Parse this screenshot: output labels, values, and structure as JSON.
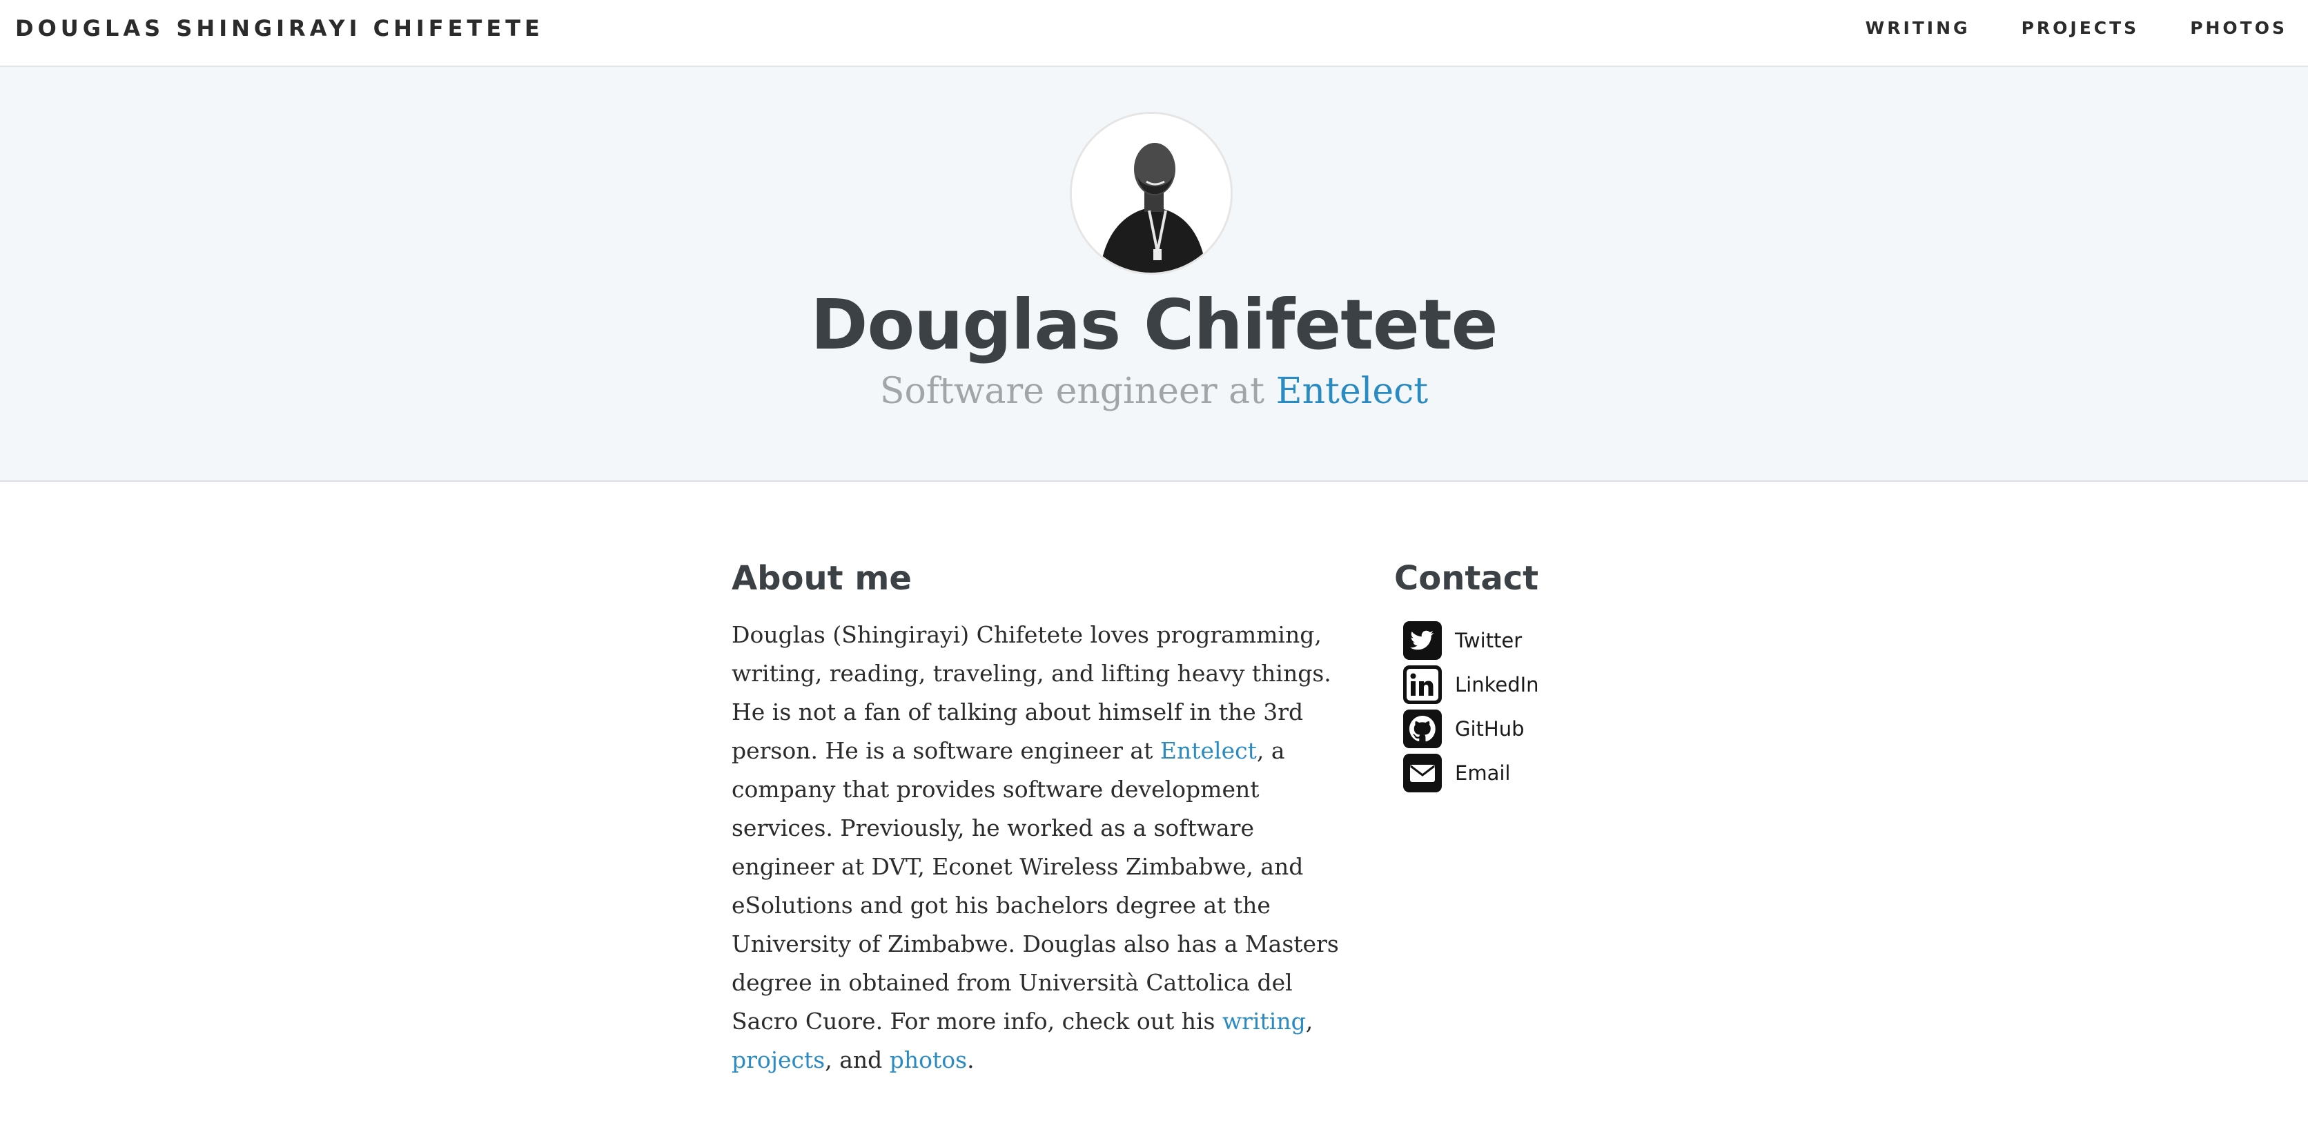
{
  "header": {
    "brand": "DOUGLAS SHINGIRAYI CHIFETETE",
    "nav": [
      {
        "label": "WRITING"
      },
      {
        "label": "PROJECTS"
      },
      {
        "label": "PHOTOS"
      }
    ]
  },
  "hero": {
    "name": "Douglas Chifetete",
    "subtitle_prefix": "Software engineer at ",
    "subtitle_company": "Entelect"
  },
  "about": {
    "title": "About me",
    "text_1": "Douglas (Shingirayi) Chifetete loves programming, writing, reading, traveling, and lifting heavy things. He is not a fan of talking about himself in the 3rd person. He is a software engineer at ",
    "company_link": "Entelect",
    "text_2": ", a company that provides software development services. Previously, he worked as a software engineer at DVT, Econet Wireless Zimbabwe, and eSolutions and got his bachelors degree at the University of Zimbabwe. Douglas also has a Masters degree in obtained from Università Cattolica del Sacro Cuore. For more info, check out his ",
    "writing_link": "writing",
    "text_3": ", ",
    "projects_link": "projects",
    "text_4": ", and ",
    "photos_link": "photos",
    "text_5": "."
  },
  "contact": {
    "title": "Contact",
    "items": [
      {
        "label": "Twitter",
        "icon": "twitter-icon"
      },
      {
        "label": "LinkedIn",
        "icon": "linkedin-icon"
      },
      {
        "label": "GitHub",
        "icon": "github-icon"
      },
      {
        "label": "Email",
        "icon": "email-icon"
      }
    ]
  },
  "colors": {
    "link": "#2a8ac2",
    "hero_bg": "#f4f7f9",
    "heading": "#3c4145"
  }
}
